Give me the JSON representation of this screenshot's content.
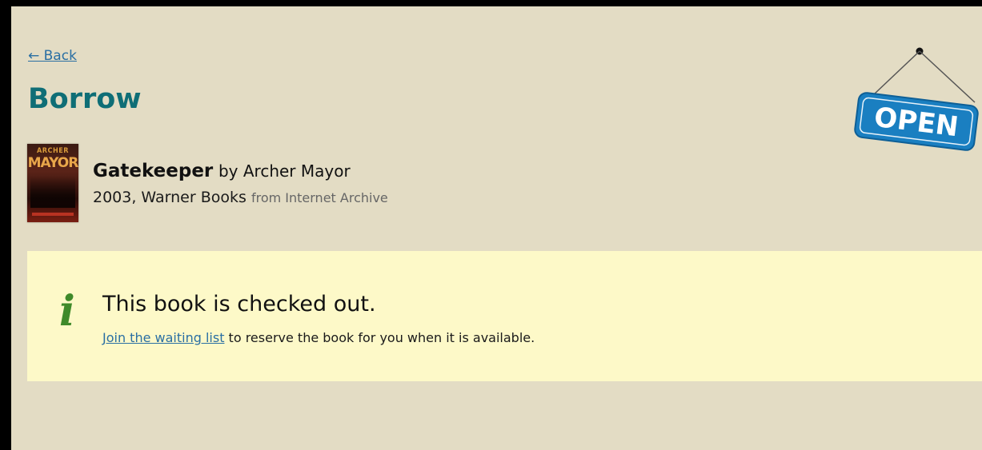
{
  "nav": {
    "back_label": "← Back"
  },
  "page": {
    "title": "Borrow"
  },
  "book": {
    "cover_top_text": "ARCHER",
    "cover_name_text": "MAYOR",
    "title": "Gatekeeper",
    "by_text": "by Archer Mayor",
    "year_publisher": "2003, Warner Books",
    "source": "from Internet Archive"
  },
  "notice": {
    "icon": "info-icon",
    "icon_glyph": "i",
    "heading": "This book is checked out.",
    "link_label": "Join the waiting list",
    "body_text": " to reserve the book for you when it is available."
  },
  "sign": {
    "text": "OPEN"
  },
  "colors": {
    "background": "#e3dcc4",
    "notice_background": "#fdf9c8",
    "title": "#0f6e76",
    "link": "#2a6fa3",
    "info_icon": "#3f8a2a",
    "sign": "#1a7fc1"
  }
}
